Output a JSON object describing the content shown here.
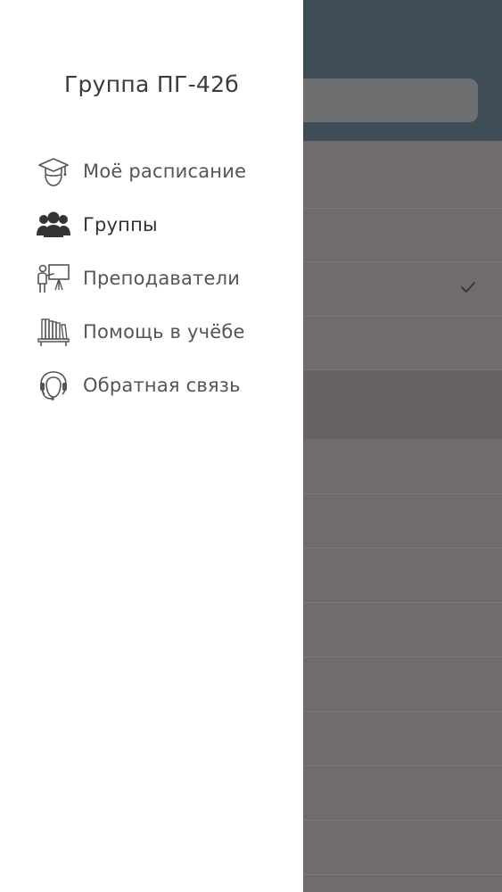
{
  "drawer": {
    "title": "Группа ПГ-42б",
    "items": [
      {
        "label": "Моё расписание",
        "icon": "graduate-icon",
        "active": false
      },
      {
        "label": "Группы",
        "icon": "group-icon",
        "active": true
      },
      {
        "label": "Преподаватели",
        "icon": "teacher-icon",
        "active": false
      },
      {
        "label": "Помощь в учёбе",
        "icon": "books-icon",
        "active": false
      },
      {
        "label": "Обратная связь",
        "icon": "support-headset-icon",
        "active": false
      }
    ]
  },
  "background": {
    "header_color": "#3f4e56",
    "overlay_color": "#6f6c6b",
    "selected_indicator": "checkmark-icon"
  }
}
